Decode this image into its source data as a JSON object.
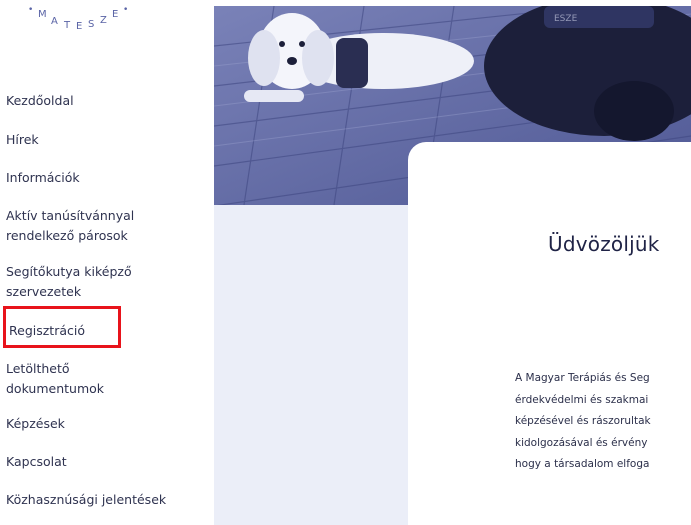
{
  "logo": {
    "text": "MATESZE",
    "letters": [
      "M",
      "A",
      "T",
      "E",
      "S",
      "Z",
      "E"
    ]
  },
  "sidebar": {
    "items": [
      {
        "label": "Kezdőoldal",
        "lines": [
          "Kezdőoldal"
        ]
      },
      {
        "label": "Hírek",
        "lines": [
          "Hírek"
        ]
      },
      {
        "label": "Információk",
        "lines": [
          "Információk"
        ]
      },
      {
        "label": "Aktív tanúsítvánnyal rendelkező párosok",
        "lines": [
          "Aktív tanúsítvánnyal",
          "rendelkező párosok"
        ]
      },
      {
        "label": "Segítőkutya kiképző szervezetek",
        "lines": [
          "Segítőkutya kiképző",
          "szervezetek"
        ]
      },
      {
        "label": "Regisztráció",
        "lines": [
          "Regisztráció"
        ],
        "highlighted": true
      },
      {
        "label": "Letölthető dokumentumok",
        "lines": [
          "Letölthető",
          "dokumentumok"
        ]
      },
      {
        "label": "Képzések",
        "lines": [
          "Képzések"
        ]
      },
      {
        "label": "Kapcsolat",
        "lines": [
          "Kapcsolat"
        ]
      },
      {
        "label": "Közhasznúsági jelentések",
        "lines": [
          "Közhasznúsági jelentések"
        ]
      }
    ]
  },
  "main": {
    "hero_image": "dogs-photo",
    "title": "Üdvözöljük",
    "body_lines": [
      "A Magyar Terápiás és Seg",
      "érdekvédelmi és szakmai",
      "képzésével és rászorultak",
      "kidolgozásával és érvény",
      "hogy a társadalom elfoga"
    ]
  },
  "colors": {
    "text": "#2f3350",
    "highlight_border": "#e8131b",
    "content_bg": "#ebeef8",
    "card_bg": "#ffffff",
    "photo_tint": "#5a64a6"
  }
}
